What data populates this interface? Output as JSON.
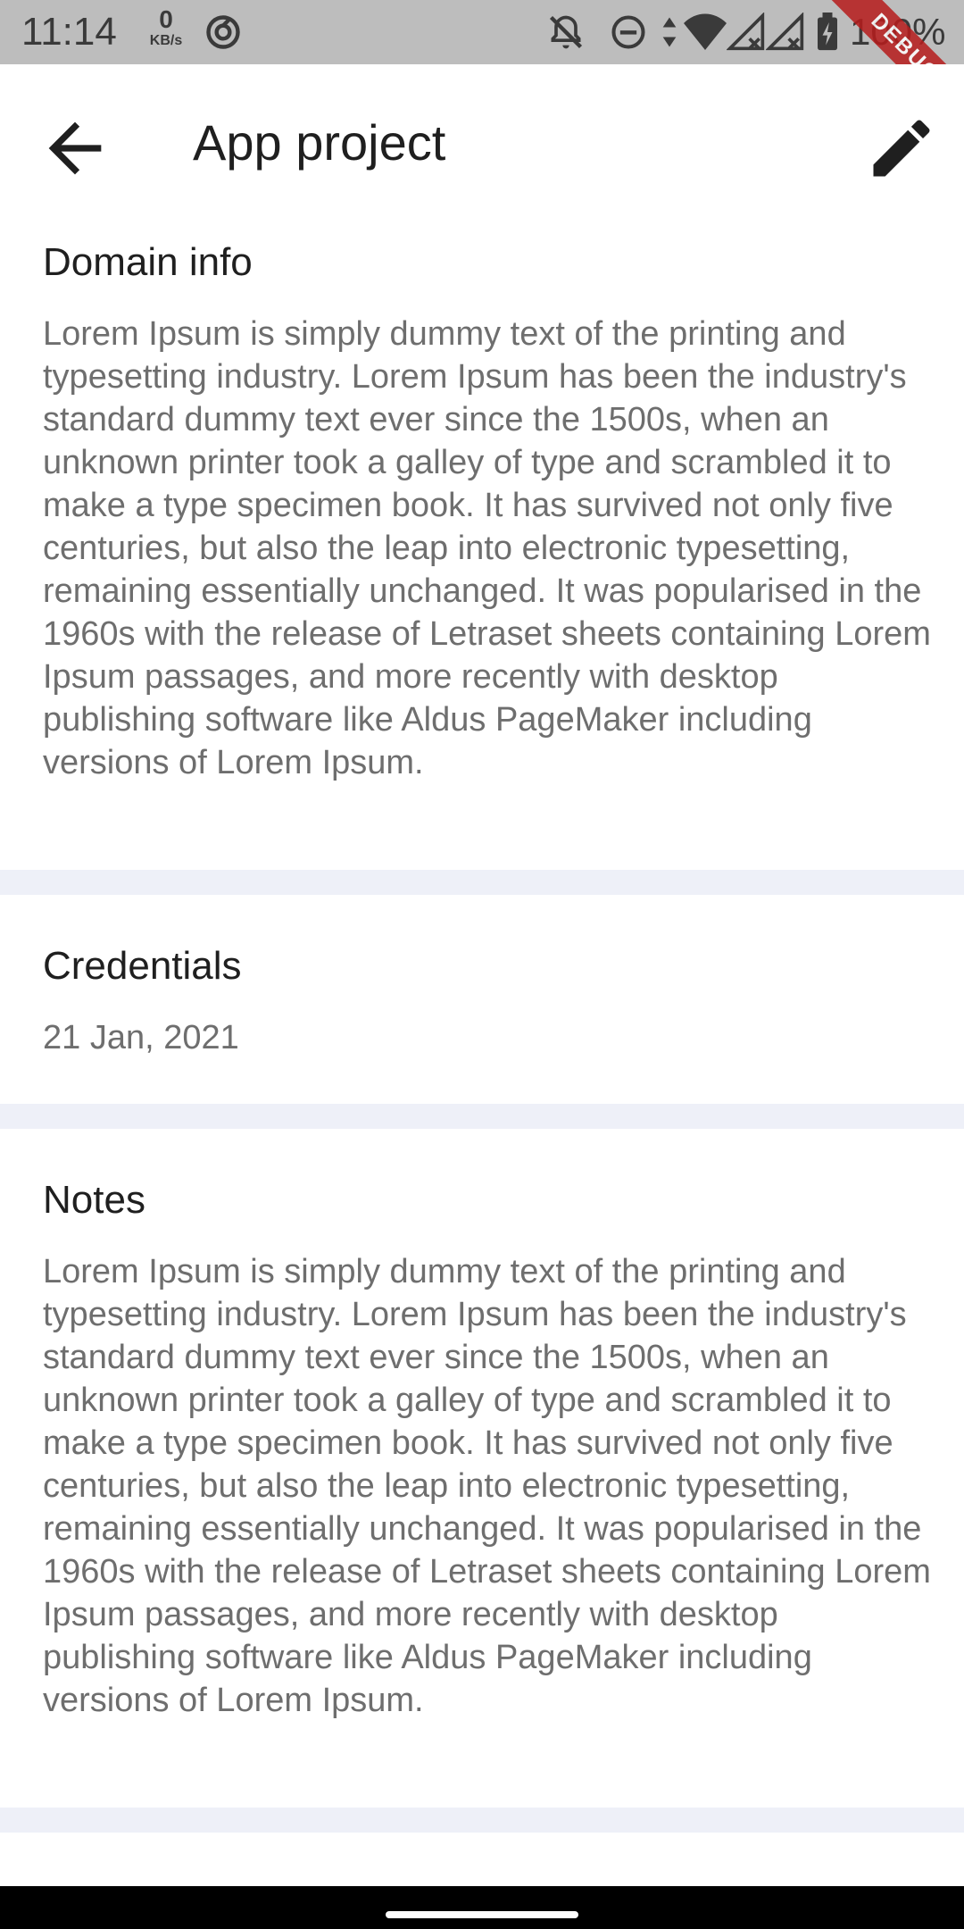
{
  "status_bar": {
    "time": "11:14",
    "net_speed_value": "0",
    "net_speed_unit": "KB/s",
    "battery": "100%"
  },
  "debug_banner": "DEBUG",
  "app_bar": {
    "title": "App project"
  },
  "sections": [
    {
      "title": "Domain info",
      "body": "Lorem Ipsum is simply dummy text of the printing and typesetting industry. Lorem Ipsum has been the industry's standard dummy text ever since the 1500s, when an unknown printer took a galley of type and scrambled it to make a type specimen book. It has survived not only five centuries, but also the leap into electronic typesetting, remaining essentially unchanged. It was popularised in the 1960s with the release of Letraset sheets containing Lorem Ipsum passages, and more recently with desktop publishing software like Aldus PageMaker including versions of Lorem Ipsum."
    },
    {
      "title": "Credentials",
      "body": "21 Jan, 2021"
    },
    {
      "title": "Notes",
      "body": "Lorem Ipsum is simply dummy text of the printing and typesetting industry. Lorem Ipsum has been the industry's standard dummy text ever since the 1500s, when an unknown printer took a galley of type and scrambled it to make a type specimen book. It has survived not only five centuries, but also the leap into electronic typesetting, remaining essentially unchanged. It was popularised in the 1960s with the release of Letraset sheets containing Lorem Ipsum passages, and more recently with desktop publishing software like Aldus PageMaker including versions of Lorem Ipsum."
    }
  ],
  "icons": {
    "back": "arrow-back-icon",
    "edit": "pencil-icon",
    "data_saver": "data-saver-icon",
    "notifications_off": "notifications-off-icon",
    "dnd": "do-not-disturb-icon",
    "data_arrows": "data-arrows-icon",
    "wifi": "wifi-icon",
    "signal": "signal-icon",
    "battery": "battery-icon"
  }
}
